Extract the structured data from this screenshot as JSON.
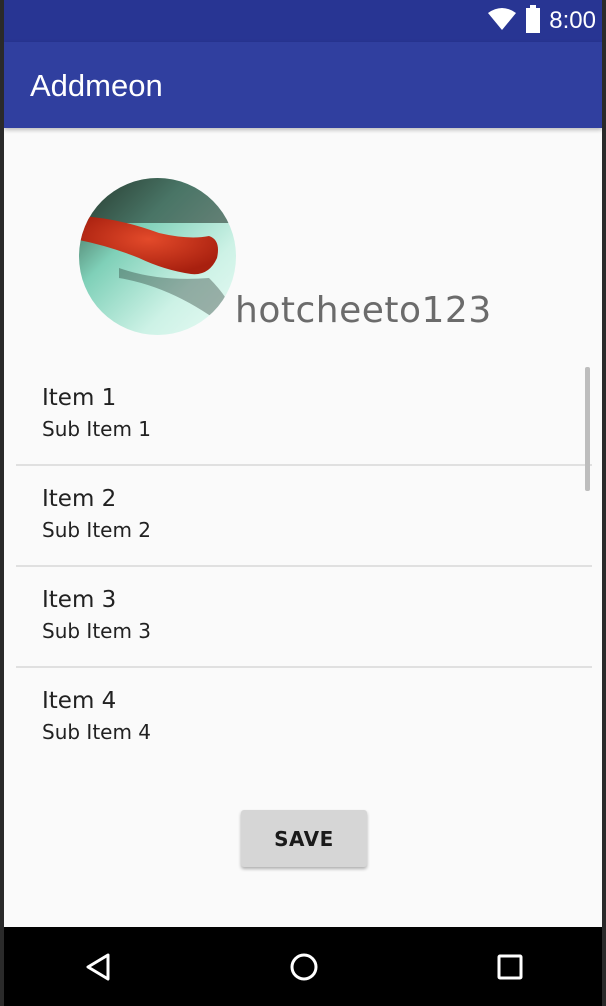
{
  "status_bar": {
    "time": "8:00",
    "icons": [
      "wifi-icon",
      "battery-icon"
    ]
  },
  "app_bar": {
    "title": "Addmeon"
  },
  "profile": {
    "username": "hotcheeto123"
  },
  "list": {
    "items": [
      {
        "title": "Item 1",
        "subtitle": "Sub Item 1"
      },
      {
        "title": "Item 2",
        "subtitle": "Sub Item 2"
      },
      {
        "title": "Item 3",
        "subtitle": "Sub Item 3"
      },
      {
        "title": "Item 4",
        "subtitle": "Sub Item 4"
      }
    ]
  },
  "actions": {
    "save_label": "SAVE"
  },
  "nav_bar": {
    "icons": [
      "back-icon",
      "home-icon",
      "recents-icon"
    ]
  },
  "colors": {
    "status_bar": "#283593",
    "app_bar": "#303f9f",
    "background": "#fafafa",
    "button": "#d6d6d6"
  }
}
